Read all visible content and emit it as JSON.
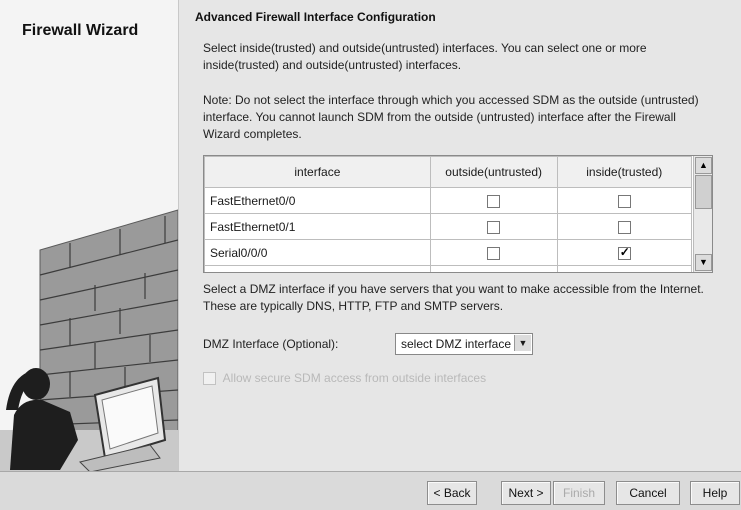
{
  "sidebar": {
    "title": "Firewall Wizard"
  },
  "main": {
    "heading": "Advanced Firewall Interface Configuration",
    "intro": "Select inside(trusted) and outside(untrusted) interfaces. You can select one or more inside(trusted) and outside(untrusted) interfaces.",
    "note": "Note: Do not select the interface through which you accessed SDM as the outside (untrusted) interface. You cannot launch SDM from the outside (untrusted) interface after the Firewall Wizard completes.",
    "table": {
      "headers": [
        "interface",
        "outside(untrusted)",
        "inside(trusted)"
      ],
      "rows": [
        {
          "interface": "FastEthernet0/0",
          "outside": false,
          "inside": false
        },
        {
          "interface": "FastEthernet0/1",
          "outside": false,
          "inside": false
        },
        {
          "interface": "Serial0/0/0",
          "outside": false,
          "inside": true
        }
      ]
    },
    "dmz_text": "Select a DMZ interface if you have servers that you want to make accessible from the Internet. These are typically DNS, HTTP, FTP and SMTP servers.",
    "dmz_label": "DMZ Interface (Optional):",
    "dmz_select_value": "select DMZ interface",
    "allow_sdm_label": "Allow secure SDM access from outside interfaces"
  },
  "footer": {
    "back": "< Back",
    "next": "Next >",
    "finish": "Finish",
    "cancel": "Cancel",
    "help": "Help"
  }
}
